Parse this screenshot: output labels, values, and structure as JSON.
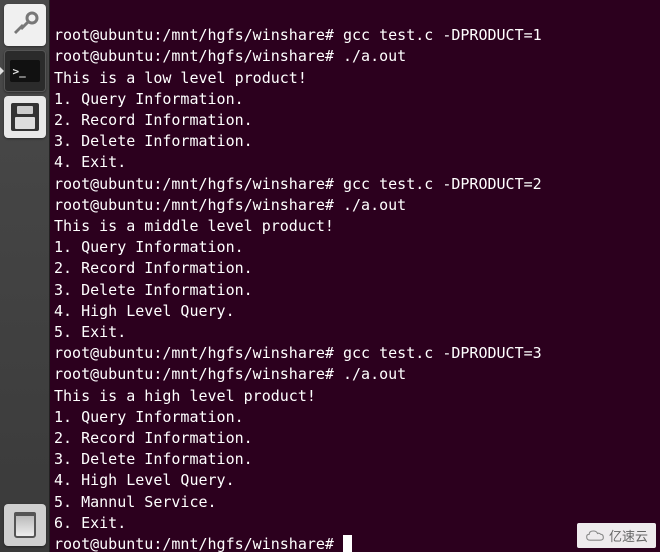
{
  "launcher": {
    "items": [
      {
        "name": "settings-icon",
        "label": "System Settings"
      },
      {
        "name": "terminal-icon",
        "label": "Terminal"
      },
      {
        "name": "save-icon",
        "label": "Save"
      },
      {
        "name": "trash-icon",
        "label": "Trash"
      }
    ]
  },
  "terminal": {
    "prompt_user": "root@ubuntu",
    "prompt_path": "/mnt/hgfs/winshare",
    "prompt_sep": "#",
    "sessions": [
      {
        "cmd_compile": "gcc test.c -DPRODUCT=1",
        "cmd_run": "./a.out",
        "header": "This is a low level product!",
        "menu": [
          "1. Query Information.",
          "2. Record Information.",
          "3. Delete Information.",
          "4. Exit."
        ]
      },
      {
        "cmd_compile": "gcc test.c -DPRODUCT=2",
        "cmd_run": "./a.out",
        "header": "This is a middle level product!",
        "menu": [
          "1. Query Information.",
          "2. Record Information.",
          "3. Delete Information.",
          "4. High Level Query.",
          "5. Exit."
        ]
      },
      {
        "cmd_compile": "gcc test.c -DPRODUCT=3",
        "cmd_run": "./a.out",
        "header": "This is a high level product!",
        "menu": [
          "1. Query Information.",
          "2. Record Information.",
          "3. Delete Information.",
          "4. High Level Query.",
          "5. Mannul Service.",
          "6. Exit."
        ]
      }
    ],
    "final_prompt": "root@ubuntu:/mnt/hgfs/winshare# "
  },
  "watermark": {
    "text": "亿速云"
  }
}
